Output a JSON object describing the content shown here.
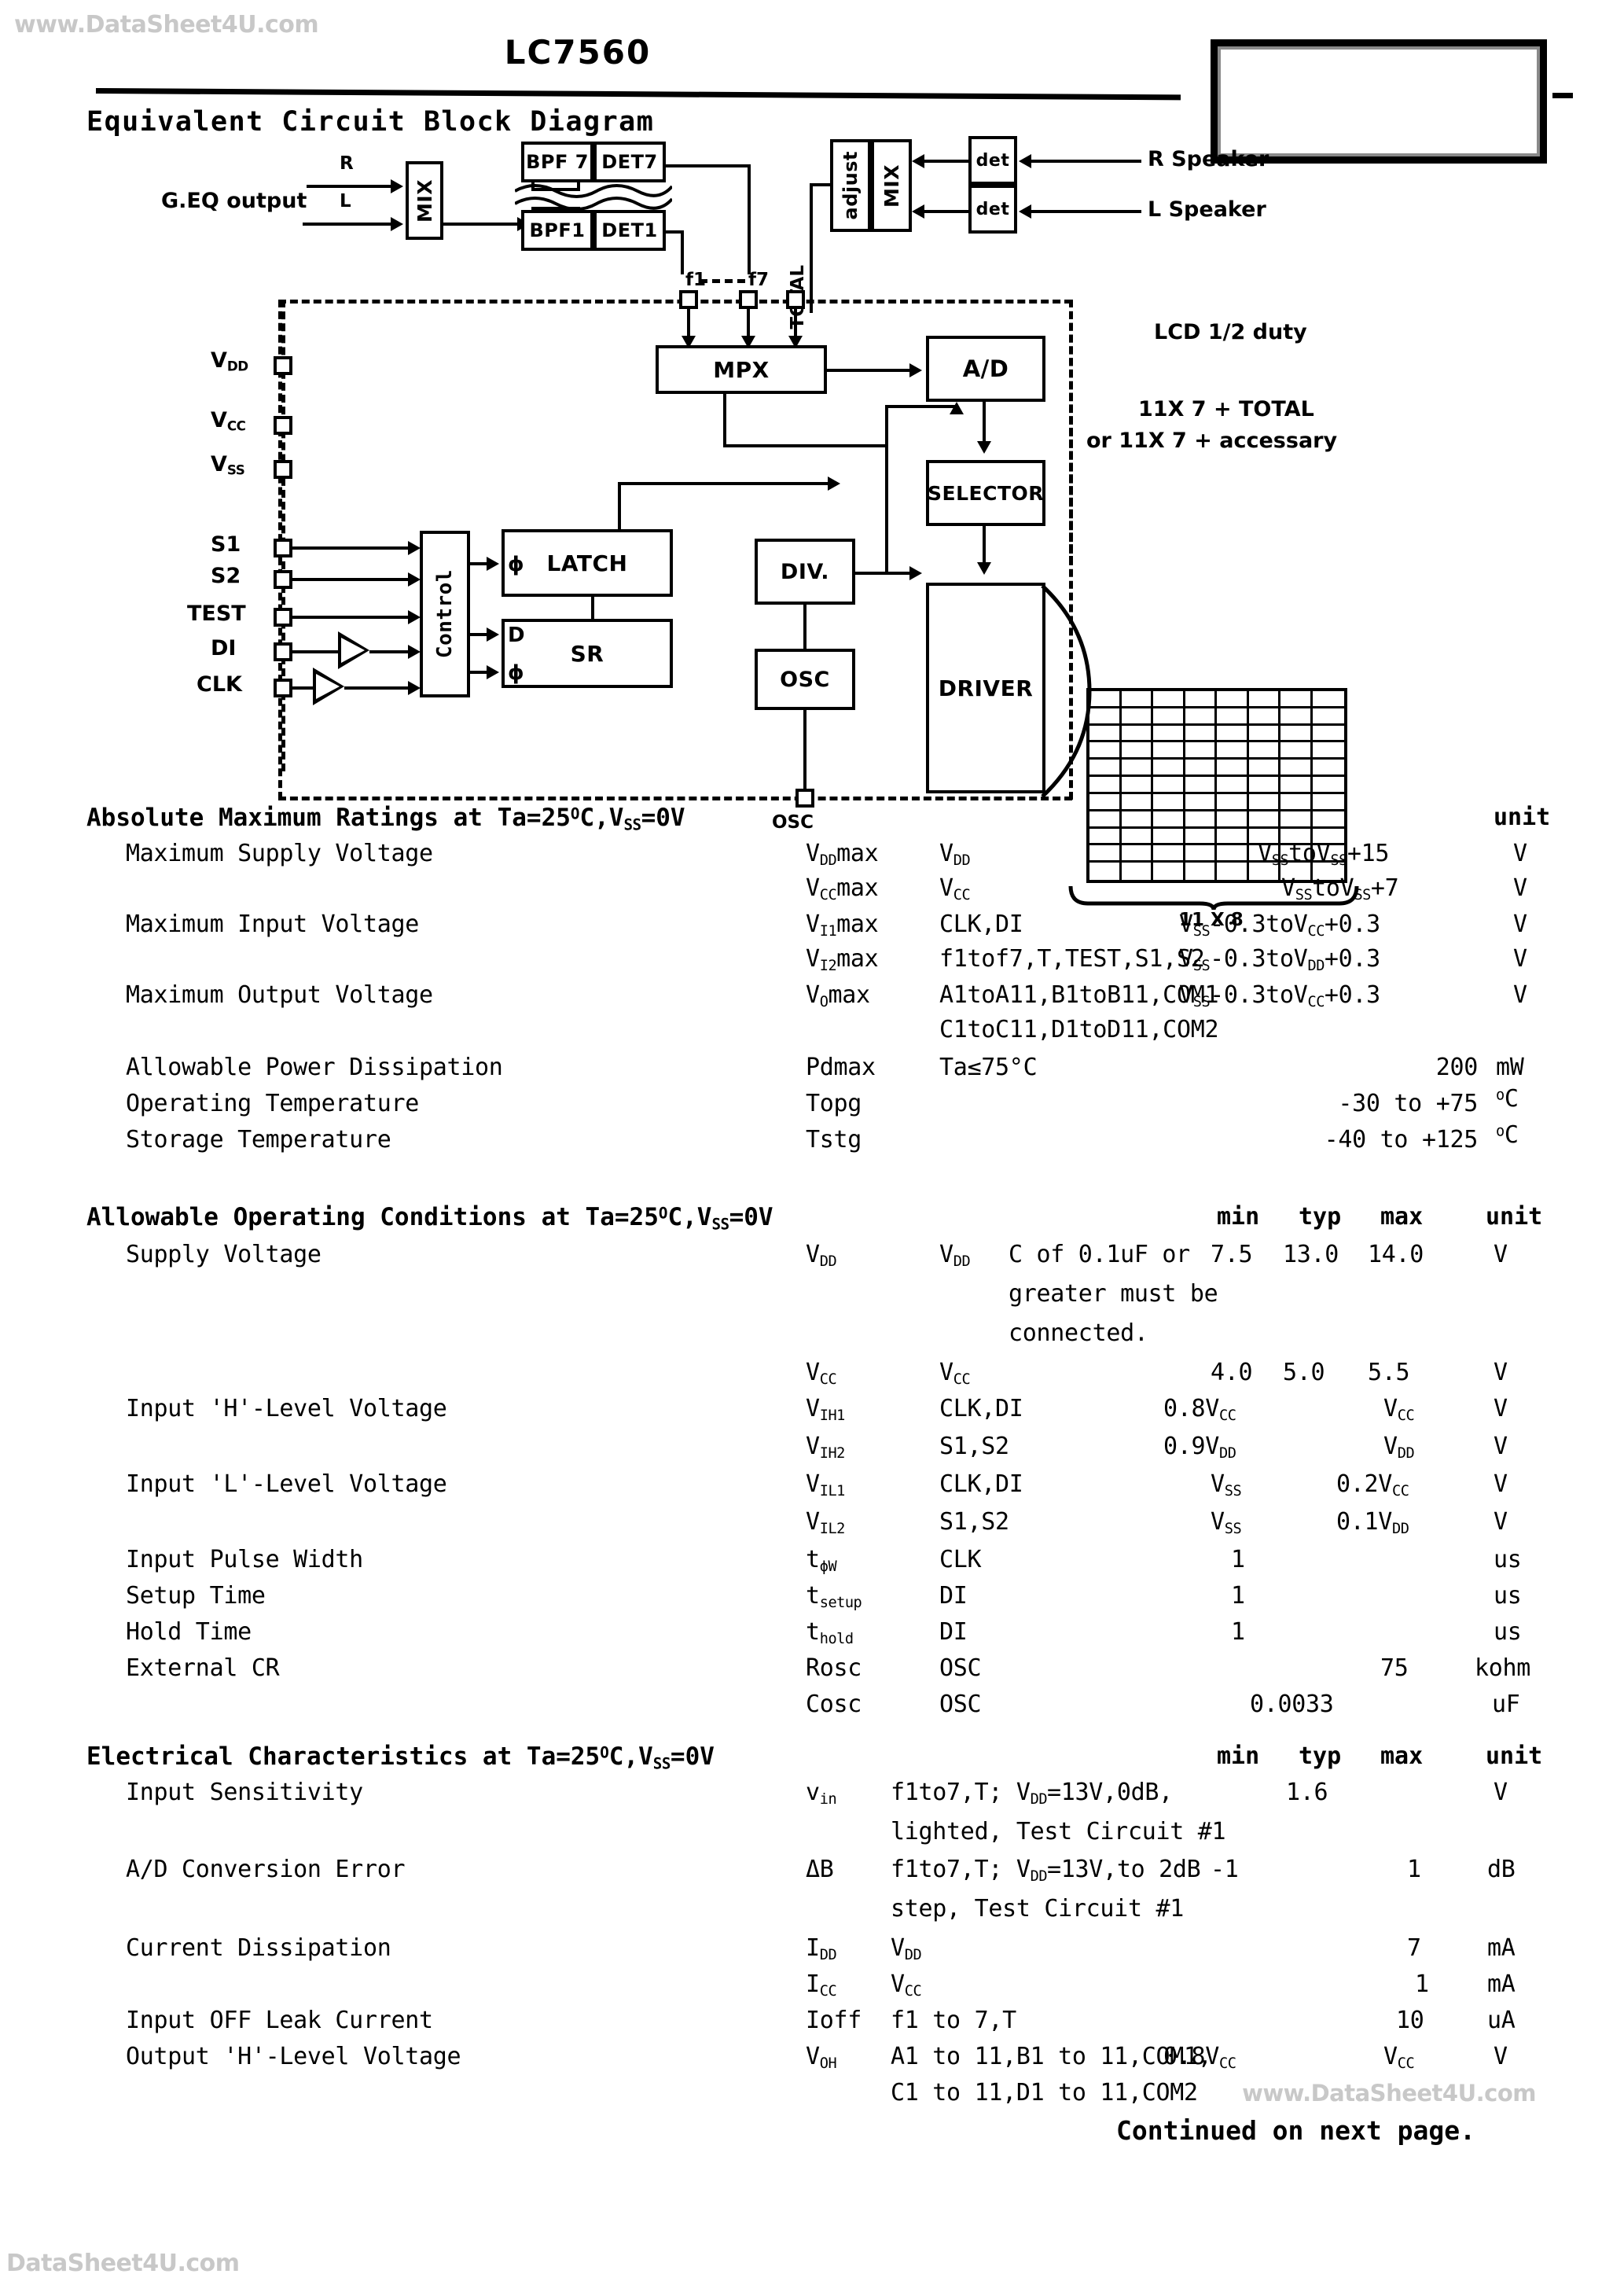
{
  "watermarks": {
    "top": "www.DataSheet4U.com",
    "middle": "www.DataSheet4U.com",
    "bottom": "DataSheet4U.com"
  },
  "header": {
    "part_number": "LC7560"
  },
  "diagram": {
    "heading": "Equivalent Circuit Block Diagram",
    "input_label": "G.EQ output",
    "input_r": "R",
    "input_l": "L",
    "mix_in": "MIX",
    "bpf7": "BPF 7",
    "det7": "DET7",
    "bpf1": "BPF1",
    "det1": "DET1",
    "adjust": "adjust",
    "mix_out": "MIX",
    "det_r": "det",
    "det_l": "det",
    "speaker_r": "R Speaker",
    "speaker_l": "L Speaker",
    "f1": "f1",
    "f7": "f7",
    "total": "TOTAL",
    "vdd": "V",
    "vdd_sub": "DD",
    "vcc": "V",
    "vcc_sub": "CC",
    "vss": "V",
    "vss_sub": "SS",
    "s1": "S1",
    "s2": "S2",
    "test": "TEST",
    "di": "DI",
    "clk": "CLK",
    "control": "Control",
    "latch": "LATCH",
    "sr": "SR",
    "phi_latch": "ϕ",
    "d_sr": "D",
    "phi_sr": "ϕ",
    "mpx": "MPX",
    "ad": "A/D",
    "selector": "SELECTOR",
    "div": "DIV.",
    "osc": "OSC",
    "osc_pin": "OSC",
    "driver": "DRIVER",
    "lcd_duty": "LCD 1/2 duty",
    "lcd_config1": "11X 7  + TOTAL",
    "lcd_config2": "or 11X 7  + accessary",
    "lcd_size": "11 X 8"
  },
  "abs_max": {
    "title": "Absolute Maximum Ratings at Ta=25",
    "title_sup": "O",
    "title_tail": "C,V",
    "title_sub": "SS",
    "title_end": "=0V",
    "unit_header": "unit",
    "rows": [
      {
        "name": "Maximum Supply Voltage",
        "symbol": "VDDmax",
        "condition": "VDD",
        "value": "VSStoVSS+15",
        "unit": "V"
      },
      {
        "name": "",
        "symbol": "VCCmax",
        "condition": "VCC",
        "value": "VSStoVSS+7",
        "unit": "V"
      },
      {
        "name": "Maximum Input Voltage",
        "symbol": "VI1max",
        "condition": "CLK,DI",
        "value": "VSS-0.3toVCC+0.3",
        "unit": "V"
      },
      {
        "name": "",
        "symbol": "VI2max",
        "condition": "f1tof7,T,TEST,S1,S2",
        "value": "VSS-0.3toVDD+0.3",
        "unit": "V"
      },
      {
        "name": "Maximum Output Voltage",
        "symbol": "VOmax",
        "condition": "A1toA11,B1toB11,COM1",
        "value": "VSS-0.3toVCC+0.3",
        "unit": "V"
      },
      {
        "name": "",
        "symbol": "",
        "condition": "C1toC11,D1toD11,COM2",
        "value": "",
        "unit": ""
      },
      {
        "name": "Allowable Power Dissipation",
        "symbol": "Pdmax",
        "condition": "Ta≤75°C",
        "value": "200",
        "unit": "mW"
      },
      {
        "name": "Operating Temperature",
        "symbol": "Topg",
        "condition": "",
        "value": "-30 to +75",
        "unit": "°C"
      },
      {
        "name": "Storage Temperature",
        "symbol": "Tstg",
        "condition": "",
        "value": "-40 to +125",
        "unit": "°C"
      }
    ]
  },
  "operating": {
    "title": "Allowable Operating Conditions at Ta=25",
    "title_sup": "O",
    "title_tail": "C,V",
    "title_sub": "SS",
    "title_end": "=0V",
    "col_min": "min",
    "col_typ": "typ",
    "col_max": "max",
    "col_unit": "unit",
    "rows": [
      {
        "name": "Supply Voltage",
        "symbol": "VDD",
        "condition": "VDD",
        "note": "C of 0.1uF or",
        "min": "7.5",
        "typ": "13.0",
        "max": "14.0",
        "unit": "V"
      },
      {
        "name": "",
        "symbol": "",
        "condition": "",
        "note": "greater must be",
        "min": "",
        "typ": "",
        "max": "",
        "unit": ""
      },
      {
        "name": "",
        "symbol": "",
        "condition": "",
        "note": "connected.",
        "min": "",
        "typ": "",
        "max": "",
        "unit": ""
      },
      {
        "name": "",
        "symbol": "VCC",
        "condition": "VCC",
        "note": "",
        "min": "4.0",
        "typ": "5.0",
        "max": "5.5",
        "unit": "V"
      },
      {
        "name": "Input 'H'-Level Voltage",
        "symbol": "VIH1",
        "condition": "CLK,DI",
        "note": "",
        "min": "0.8VCC",
        "typ": "",
        "max": "VCC",
        "unit": "V"
      },
      {
        "name": "",
        "symbol": "VIH2",
        "condition": "S1,S2",
        "note": "",
        "min": "0.9VDD",
        "typ": "",
        "max": "VDD",
        "unit": "V"
      },
      {
        "name": "Input 'L'-Level Voltage",
        "symbol": "VIL1",
        "condition": "CLK,DI",
        "note": "",
        "min": "VSS",
        "typ": "",
        "max": "0.2VCC",
        "unit": "V"
      },
      {
        "name": "",
        "symbol": "VIL2",
        "condition": "S1,S2",
        "note": "",
        "min": "VSS",
        "typ": "",
        "max": "0.1VDD",
        "unit": "V"
      },
      {
        "name": "Input Pulse Width",
        "symbol": "tϕW",
        "condition": "CLK",
        "note": "",
        "min": "1",
        "typ": "",
        "max": "",
        "unit": "us"
      },
      {
        "name": "Setup Time",
        "symbol": "tsetup",
        "condition": "DI",
        "note": "",
        "min": "1",
        "typ": "",
        "max": "",
        "unit": "us"
      },
      {
        "name": "Hold Time",
        "symbol": "thold",
        "condition": "DI",
        "note": "",
        "min": "1",
        "typ": "",
        "max": "",
        "unit": "us"
      },
      {
        "name": "External CR",
        "symbol": "Rosc",
        "condition": "OSC",
        "note": "",
        "min": "",
        "typ": "",
        "max": "75",
        "unit": "kohm"
      },
      {
        "name": "",
        "symbol": "Cosc",
        "condition": "OSC",
        "note": "",
        "min": "",
        "typ": "0.0033",
        "max": "",
        "unit": "uF"
      }
    ]
  },
  "electrical": {
    "title": "Electrical Characteristics at Ta=25",
    "title_sup": "O",
    "title_tail": "C,V",
    "title_sub": "SS",
    "title_end": "=0V",
    "col_min": "min",
    "col_typ": "typ",
    "col_max": "max",
    "col_unit": "unit",
    "rows": [
      {
        "name": "Input Sensitivity",
        "symbol": "vin",
        "condition": "f1to7,T; VDD=13V,0dB,",
        "min": "",
        "typ": "1.6",
        "max": "",
        "unit": "V"
      },
      {
        "name": "",
        "symbol": "",
        "condition": "lighted, Test Circuit #1",
        "min": "",
        "typ": "",
        "max": "",
        "unit": ""
      },
      {
        "name": "A/D Conversion Error",
        "symbol": "ΔB",
        "condition": "f1to7,T; VDD=13V,to 2dB",
        "min": "-1",
        "typ": "",
        "max": "1",
        "unit": "dB"
      },
      {
        "name": "",
        "symbol": "",
        "condition": "step, Test Circuit #1",
        "min": "",
        "typ": "",
        "max": "",
        "unit": ""
      },
      {
        "name": "Current Dissipation",
        "symbol": "IDD",
        "condition": "VDD",
        "min": "",
        "typ": "",
        "max": "7",
        "unit": "mA"
      },
      {
        "name": "",
        "symbol": "ICC",
        "condition": "VCC",
        "min": "",
        "typ": "",
        "max": "1",
        "unit": "mA"
      },
      {
        "name": "Input OFF Leak Current",
        "symbol": "Ioff",
        "condition": "f1 to 7,T",
        "min": "",
        "typ": "",
        "max": "10",
        "unit": "uA"
      },
      {
        "name": "Output 'H'-Level Voltage",
        "symbol": "VOH",
        "condition": "A1 to 11,B1 to 11,COM1,",
        "min": "0.8VCC",
        "typ": "",
        "max": "VCC",
        "unit": "V"
      },
      {
        "name": "",
        "symbol": "",
        "condition": "C1 to 11,D1 to 11,COM2",
        "min": "",
        "typ": "",
        "max": "",
        "unit": ""
      }
    ]
  },
  "footer": {
    "continued": "Continued on next page."
  }
}
